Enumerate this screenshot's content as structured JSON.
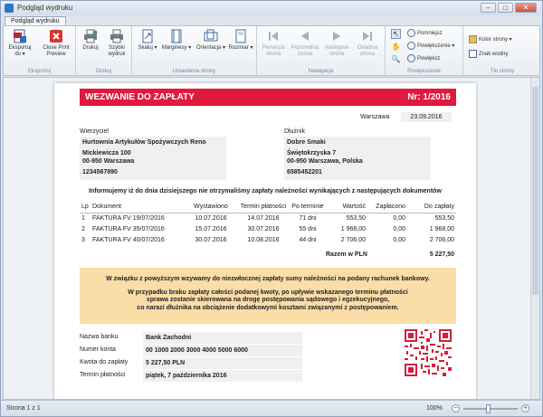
{
  "window": {
    "title": "Podgląd wydruku"
  },
  "tab": {
    "label": "Podgląd wydruku"
  },
  "ribbon": {
    "groups": [
      {
        "label": "Eksportuj",
        "buttons": [
          {
            "label": "Eksportuj do ▾",
            "icon": "pdf-export-icon"
          },
          {
            "label": "Close Print Preview",
            "icon": "close-preview-icon"
          }
        ]
      },
      {
        "label": "Drukuj",
        "buttons": [
          {
            "label": "Drukuj",
            "icon": "printer-icon"
          },
          {
            "label": "Szybki wydruk",
            "icon": "quick-print-icon"
          }
        ]
      },
      {
        "label": "Ustawienia strony",
        "buttons": [
          {
            "label": "Skaluj ▾",
            "icon": "scale-icon"
          },
          {
            "label": "Marginesy ▾",
            "icon": "margins-icon"
          },
          {
            "label": "Orientacja ▾",
            "icon": "orientation-icon"
          },
          {
            "label": "Rozmiar ▾",
            "icon": "page-size-icon"
          }
        ]
      },
      {
        "label": "Nawigacja",
        "buttons": [
          {
            "label": "Pierwsza strona",
            "icon": "first-page-icon"
          },
          {
            "label": "Poprzednia strona",
            "icon": "previous-page-icon"
          },
          {
            "label": "Następna strona",
            "icon": "next-page-icon"
          },
          {
            "label": "Ostatnia strona",
            "icon": "last-page-icon"
          }
        ]
      },
      {
        "label": "Powiększenie",
        "buttons": [
          {
            "label": "Pomniejsz",
            "icon": "zoom-out-icon"
          },
          {
            "label": "Powiększenie ▾",
            "icon": "zoom-icon"
          },
          {
            "label": "Powiększ",
            "icon": "zoom-in-icon"
          }
        ]
      },
      {
        "label": "Tło strony",
        "buttons": [
          {
            "label": "Kolor strony ▾",
            "icon": "page-color-icon"
          },
          {
            "label": "Znak wodny",
            "icon": "watermark-icon"
          }
        ]
      }
    ]
  },
  "document": {
    "header": {
      "title": "WEZWANIE DO ZAPŁATY",
      "number": "Nr: 1/2016"
    },
    "city": "Warszawa",
    "date": "23.09.2016",
    "creditor": {
      "label": "Wierzyciel",
      "name": "Hurtownia Artykułów Spożywczych Reno",
      "street": "Mickiewicza 100",
      "city": "00-950 Warszawa",
      "phone": "1234567890"
    },
    "debtor": {
      "label": "Dłużnik",
      "name": "Dobre Smaki",
      "street": "Świętokrzyska 7",
      "city": "00-950 Warszawa, Polska",
      "phone": "6585452201"
    },
    "info_text": "Informujemy iż do dnia dzisiejszego nie otrzymaliśmy zapłaty należności wynikających z następujących dokumentów",
    "table": {
      "headers": [
        "Lp",
        "Dokument",
        "Wystawiono",
        "Termin płatności",
        "Po terminie",
        "Wartość",
        "Zapłacono",
        "Do zapłaty"
      ],
      "rows": [
        [
          "1",
          "FAKTURA FV 19/07/2016",
          "10.07.2016",
          "14.07.2016",
          "71 dni",
          "553,50",
          "0,00",
          "553,50"
        ],
        [
          "2",
          "FAKTURA FV 35/07/2016",
          "15.07.2016",
          "30.07.2016",
          "55 dni",
          "1 968,00",
          "0,00",
          "1 968,00"
        ],
        [
          "3",
          "FAKTURA FV 40/07/2016",
          "30.07.2016",
          "10.08.2016",
          "44 dni",
          "2 706,00",
          "0,00",
          "2 706,00"
        ]
      ],
      "total_label": "Razem w PLN",
      "total_value": "5 227,50"
    },
    "notice": {
      "line1": "W związku z powyższym wzywamy do niezwłocznej zapłaty sumy należności na podany rachunek bankowy.",
      "line2": "W przypadku braku zapłaty całości podanej kwoty, po upływie wskazanego terminu płatności",
      "line3": "sprawa zostanie skierowana na drogę postępowania sądowego i egzekucyjnego,",
      "line4": "co narazi dłużnika na obciążenie dodatkowymi kosztami związanymi z postępowaniem."
    },
    "bank": {
      "rows": [
        {
          "label": "Nazwa banku",
          "value": "Bank Zachodni"
        },
        {
          "label": "Numer konta",
          "value": "00 1000 2000 3000 4000 5000 6000"
        },
        {
          "label": "Kwota do zapłaty",
          "value": "5 227,50 PLN"
        },
        {
          "label": "Termin płatności",
          "value": "piątek, 7 października 2016"
        }
      ]
    }
  },
  "status": {
    "page": "Strona 1 z 1",
    "zoom": "100%"
  },
  "colors": {
    "header_red": "#e0193f",
    "notice_bg": "#fbdda8",
    "qr": "#d21f3c"
  }
}
